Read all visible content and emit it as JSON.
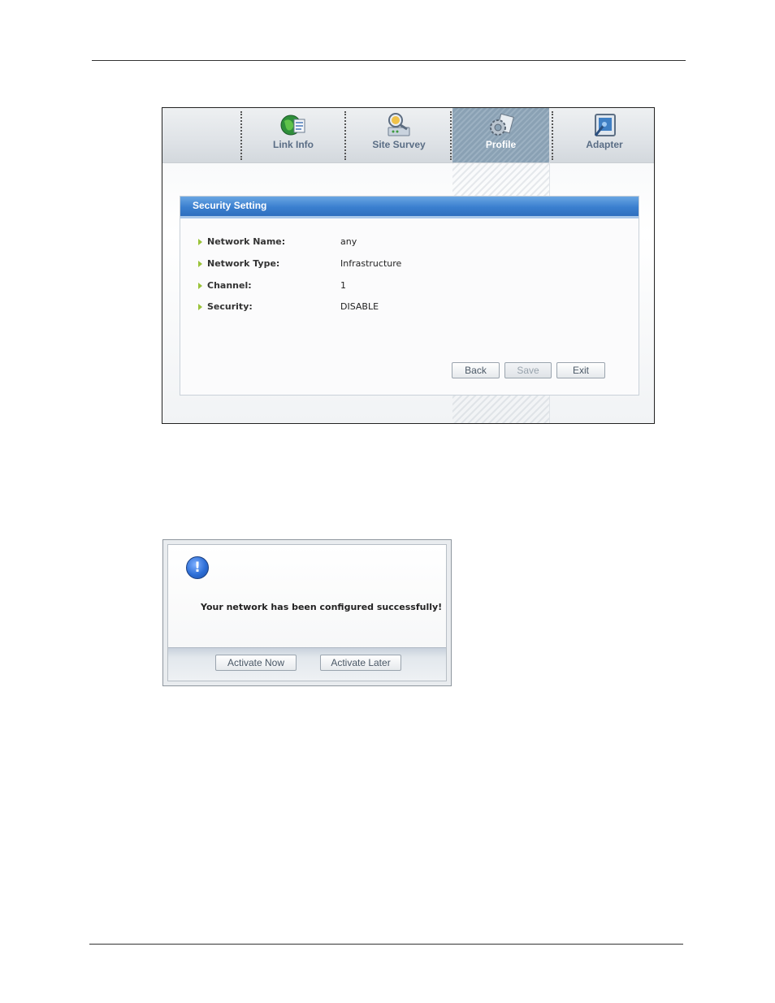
{
  "window": {
    "tabs": [
      {
        "label": "Link Info",
        "icon": "globe-document-icon"
      },
      {
        "label": "Site Survey",
        "icon": "site-survey-icon"
      },
      {
        "label": "Profile",
        "icon": "gear-profile-icon",
        "active": true
      },
      {
        "label": "Adapter",
        "icon": "adapter-icon"
      }
    ],
    "panel": {
      "title": "Security Setting",
      "fields": [
        {
          "label": "Network Name:",
          "value": "any"
        },
        {
          "label": "Network Type:",
          "value": "Infrastructure"
        },
        {
          "label": "Channel:",
          "value": "1"
        },
        {
          "label": "Security:",
          "value": "DISABLE"
        }
      ],
      "buttons": {
        "back": "Back",
        "save": "Save",
        "exit": "Exit"
      }
    }
  },
  "dialog": {
    "icon": "info-icon",
    "icon_glyph": "!",
    "message": "Your network has been configured successfully!",
    "buttons": {
      "activate_now": "Activate Now",
      "activate_later": "Activate Later"
    }
  },
  "colors": {
    "accent": "#3a7fcf",
    "bullet": "#9ac33a",
    "tab_label": "#5a6d85"
  }
}
